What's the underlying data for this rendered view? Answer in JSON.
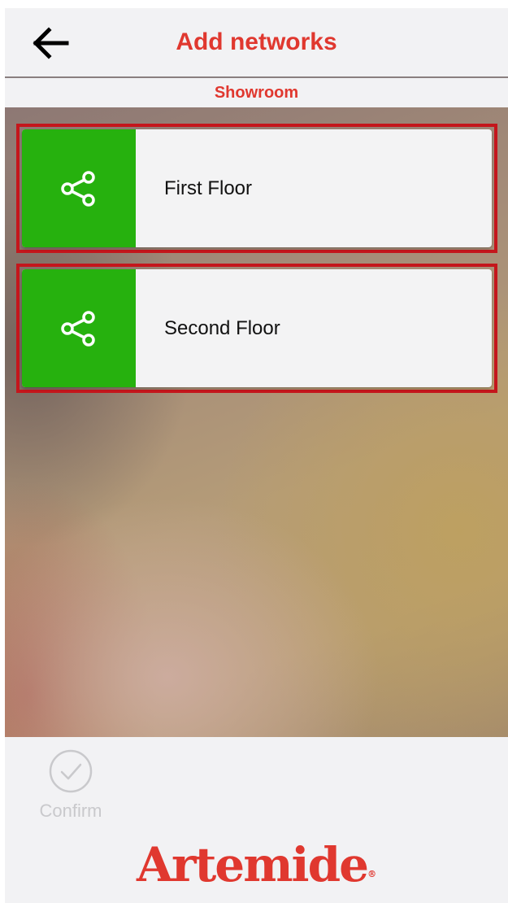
{
  "header": {
    "title": "Add networks",
    "back_icon": "arrow-left-icon"
  },
  "subtitle": "Showroom",
  "networks": [
    {
      "label": "First Floor",
      "icon": "share-icon",
      "selected": true
    },
    {
      "label": "Second Floor",
      "icon": "share-icon",
      "selected": true
    }
  ],
  "footer": {
    "confirm_label": "Confirm",
    "confirm_icon": "check-circle-icon",
    "logo_text": "Artemide",
    "logo_mark": "®"
  },
  "colors": {
    "accent": "#e0382f",
    "network_green": "#26b10e",
    "selection_border": "#c4161c",
    "background": "#f2f2f4"
  }
}
